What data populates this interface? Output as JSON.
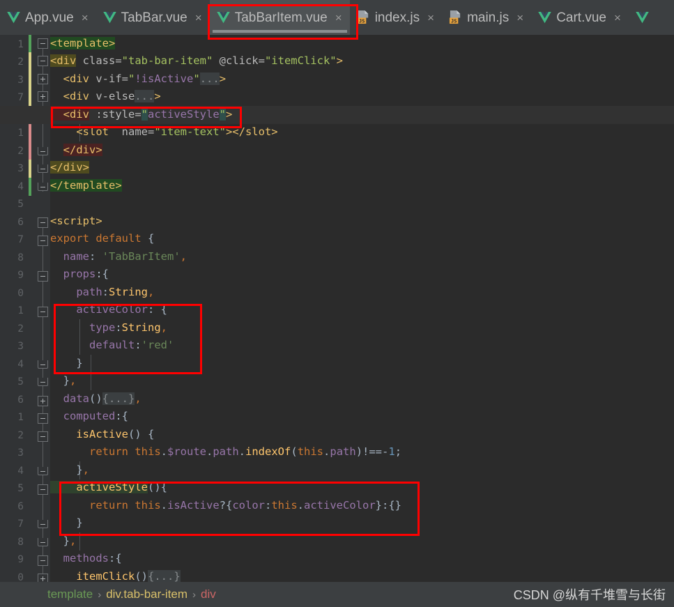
{
  "window": {
    "background": "#2b2b2b",
    "accent_red": "#ff0000"
  },
  "tabs": [
    {
      "label": "App.vue",
      "icon": "vue-icon",
      "active": false,
      "close": "×"
    },
    {
      "label": "TabBar.vue",
      "icon": "vue-icon",
      "active": false,
      "close": "×"
    },
    {
      "label": "TabBarItem.vue",
      "icon": "vue-icon",
      "active": true,
      "close": "×"
    },
    {
      "label": "index.js",
      "icon": "js-icon",
      "active": false,
      "close": "×"
    },
    {
      "label": "main.js",
      "icon": "js-icon",
      "active": false,
      "close": "×"
    },
    {
      "label": "Cart.vue",
      "icon": "vue-icon",
      "active": false,
      "close": "×"
    },
    {
      "label": "",
      "icon": "vue-icon",
      "active": false,
      "close": ""
    }
  ],
  "editor": {
    "line_numbers": [
      "1",
      "2",
      "3",
      "7",
      "0",
      "1",
      "2",
      "3",
      "4",
      "5",
      "6",
      "7",
      "8",
      "9",
      "0",
      "1",
      "2",
      "3",
      "4",
      "5",
      "6",
      "1",
      "2",
      "3",
      "4",
      "5",
      "6",
      "7",
      "8",
      "9",
      "0"
    ],
    "current_line_number": "0",
    "lines": [
      "<template>",
      "<div class=\"tab-bar-item\" @click=\"itemClick\">",
      "  <div v-if=\"!isActive\"...>",
      "  <div v-else...>",
      "  <div :style=\"activeStyle\">",
      "    <slot  name=\"item-text\"></slot>",
      "  </div>",
      "</div>",
      "</template>",
      "",
      "<script>",
      "export default {",
      "  name: 'TabBarItem',",
      "  props:{",
      "    path:String,",
      "    activeColor: {",
      "      type:String,",
      "      default:'red'",
      "    }",
      "  },",
      "  data(){...},",
      "  computed:{",
      "    isActive() {",
      "      return this.$route.path.indexOf(this.path)!==-1;",
      "    },",
      "    activeStyle(){",
      "      return this.isActive?{color:this.activeColor}:{}",
      "    }",
      "  },",
      "  methods:{",
      "    itemClick(){...}"
    ]
  },
  "annotations": {
    "highlight_boxes": [
      {
        "name": "tab-highlight",
        "target": "TabBarItem.vue tab"
      },
      {
        "name": "style-binding-highlight",
        "target": "<div :style=\"activeStyle\">"
      },
      {
        "name": "active-color-highlight",
        "target": "activeColor prop block"
      },
      {
        "name": "active-style-highlight",
        "target": "activeStyle computed block"
      }
    ]
  },
  "breadcrumb": {
    "items": [
      "template",
      "div.tab-bar-item",
      "div"
    ],
    "separator": "›"
  },
  "watermark": {
    "text": "CSDN @纵有千堆雪与长街"
  }
}
